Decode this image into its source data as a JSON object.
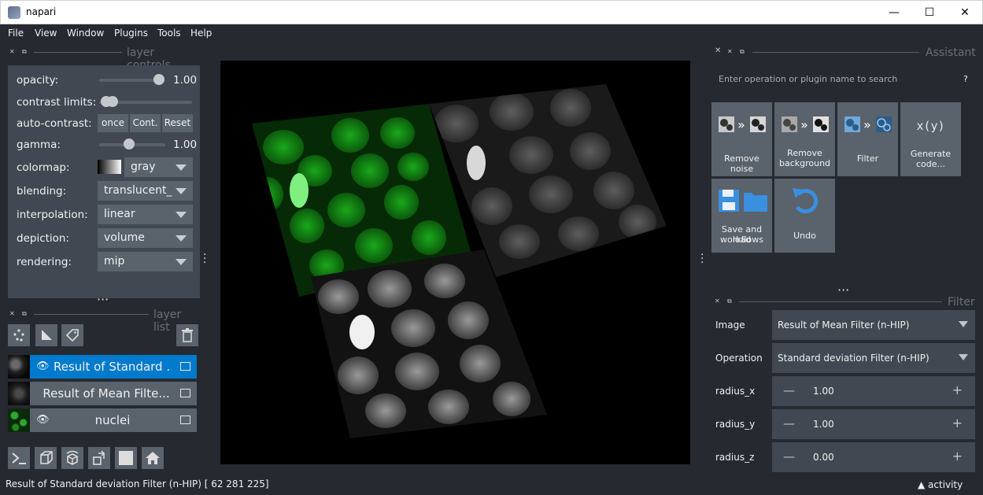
{
  "window": {
    "title": "napari",
    "minimize": "—",
    "maximize": "☐",
    "close": "✕"
  },
  "menu": [
    "File",
    "Window",
    "Plugins",
    "Tools",
    "Help",
    "View"
  ],
  "layer_controls": {
    "header": "layer controls",
    "opacity_label": "opacity:",
    "opacity_value": "1.00",
    "opacity_level": 1.0,
    "contrast_label": "contrast limits:",
    "autocontrast_label": "auto-contrast:",
    "once": "once",
    "cont": "Cont.",
    "reset": "Reset",
    "gamma_label": "gamma:",
    "gamma_value": "1.00",
    "colormap_label": "colormap:",
    "colormap_value": "gray",
    "blending_label": "blending:",
    "blending_value": "translucent_",
    "interpolation_label": "interpolation:",
    "interpolation_value": "linear",
    "depiction_label": "depiction:",
    "depiction_value": "volume",
    "rendering_label": "rendering:",
    "rendering_value": "mip"
  },
  "layer_list": {
    "header": "layer list",
    "layers": [
      {
        "name": "Result of Standard ...",
        "selected": true
      },
      {
        "name": "Result of Mean Filte...",
        "selected": false
      },
      {
        "name": "nuclei",
        "selected": false
      }
    ]
  },
  "assistant": {
    "header": "Assistant",
    "search_placeholder": "Enter operation or plugin name to search",
    "help": "?",
    "tiles": [
      {
        "line1": "Remove noise",
        "line2": ""
      },
      {
        "line1": "Remove",
        "line2": "background"
      },
      {
        "line1": "Filter",
        "line2": ""
      },
      {
        "line1": "Generate",
        "line2": "code..."
      },
      {
        "line1": "Save and load",
        "line2": "workflows"
      },
      {
        "line1": "Undo",
        "line2": ""
      }
    ],
    "generate_icon_text": "x(y)"
  },
  "filter": {
    "header": "Filter",
    "image_label": "Image",
    "image_value": "Result of Mean Filter (n-HIP)",
    "operation_label": "Operation",
    "operation_value": "Standard deviation Filter (n-HIP)",
    "radius_x_label": "radius_x",
    "radius_x": "1.00",
    "radius_y_label": "radius_y",
    "radius_y": "1.00",
    "radius_z_label": "radius_z",
    "radius_z": "0.00"
  },
  "status": {
    "message": "Result of Standard deviation Filter (n-HIP) [ 62 281 225]",
    "activity": "activity"
  },
  "colors": {
    "accent": "#007acc",
    "background": "#262930",
    "panel": "#414851",
    "widget": "#5a626c"
  },
  "icons": [
    "napari-icon",
    "float-icon",
    "close-icon",
    "points-icon",
    "shapes-icon",
    "labels-icon",
    "delete-icon",
    "console-icon",
    "ndisplay-icon",
    "roll-icon",
    "transpose-icon",
    "grid-icon",
    "home-icon",
    "eye-icon",
    "image-icon"
  ]
}
